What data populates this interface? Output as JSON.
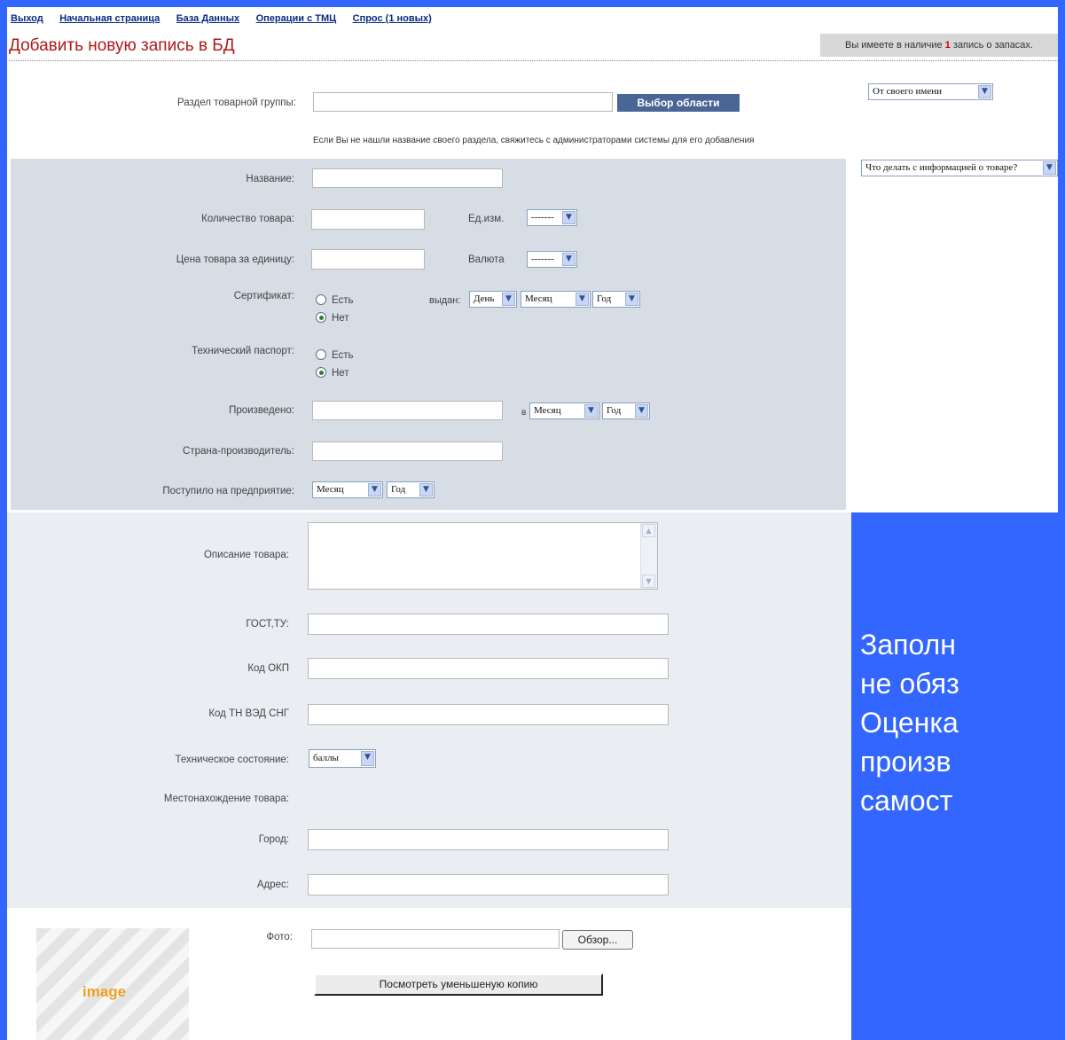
{
  "nav": [
    "Выход",
    "Начальная страница",
    "База Данных",
    "Операции с ТМЦ",
    "Спрос (1 новых)"
  ],
  "page_title": "Добавить новую запись в БД",
  "stock_notice": {
    "before": "Вы имеете в наличие ",
    "count": "1",
    "after": " запись о запасах."
  },
  "side": {
    "from_select": "От своего имени",
    "what_select": "Что делать с информацией о товаре?"
  },
  "group": {
    "label": "Раздел товарной группы:",
    "button": "Выбор области",
    "hint": "Если Вы не нашли название своего раздела, свяжитесь с администраторами системы для его добавления"
  },
  "form": {
    "name_label": "Название:",
    "qty_label": "Количество товара:",
    "unit_label": "Ед.изм.",
    "unit_value": "-------",
    "price_label": "Цена товара за единицу:",
    "currency_label": "Валюта",
    "currency_value": "-------",
    "cert_label": "Сертификат:",
    "yes": "Есть",
    "no": "Нет",
    "issued_label": "выдан:",
    "day": "День",
    "month": "Месяц",
    "year": "Год",
    "passport_label": "Технический паспорт:",
    "produced_label": "Произведено:",
    "in_label": "в",
    "country_label": "Страна-производитель:",
    "received_label": "Поступило на предприятие:"
  },
  "form2": {
    "desc_label": "Описание товара:",
    "gost_label": "ГОСТ,ТУ:",
    "okp_label": "Код ОКП",
    "tnved_label": "Код ТН ВЭД СНГ",
    "tech_label": "Техническое состояние:",
    "tech_value": "баллы",
    "location_label": "Местонахождение товара:",
    "city_label": "Город:",
    "address_label": "Адрес:",
    "photo_label": "Фото:",
    "browse_button": "Обзор...",
    "preview_button": "Посмотреть уменьшеную копию",
    "image_placeholder": "image"
  },
  "overlay_lines": [
    "Заполн",
    "не обяз",
    "Оценка",
    "произв",
    "самост"
  ]
}
